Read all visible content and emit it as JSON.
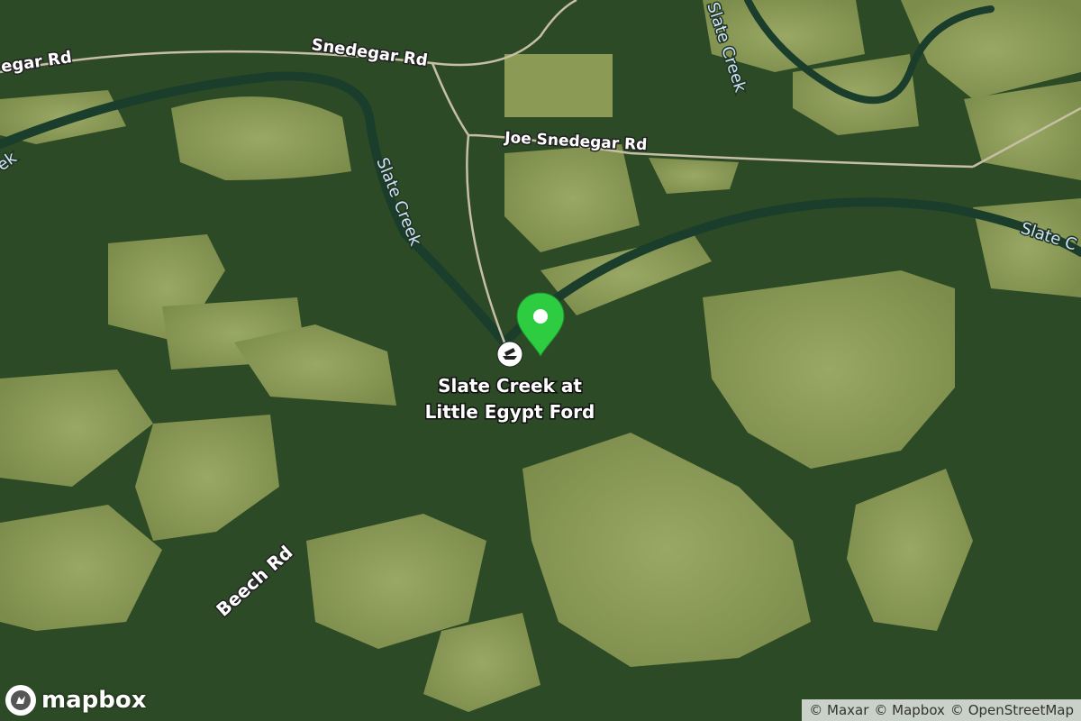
{
  "map": {
    "roads": [
      {
        "id": "snedegar-left",
        "name": "egar Rd"
      },
      {
        "id": "snedegar",
        "name": "Snedegar Rd"
      },
      {
        "id": "joe-snedegar",
        "name": "Joe Snedegar Rd"
      },
      {
        "id": "beech",
        "name": "Beech Rd"
      }
    ],
    "waterways": [
      {
        "id": "slate-left",
        "name": "ek"
      },
      {
        "id": "slate-top",
        "name": "Slate Creek"
      },
      {
        "id": "slate-mid",
        "name": "Slate Creek"
      },
      {
        "id": "slate-right",
        "name": "Slate C"
      }
    ],
    "poi": {
      "line1": "Slate Creek at",
      "line2": "Little Egypt Ford",
      "icon": "boat-launch-icon"
    },
    "marker": {
      "icon": "location-pin-icon",
      "color": "#2ecc40"
    }
  },
  "branding": {
    "logo_text": "mapbox"
  },
  "attribution": [
    "© Maxar",
    "© Mapbox",
    "© OpenStreetMap"
  ],
  "colors": {
    "forest": "#24401f",
    "field": "#8a9a56",
    "water": "#1a3a2a",
    "road": "#c9c2aa"
  }
}
